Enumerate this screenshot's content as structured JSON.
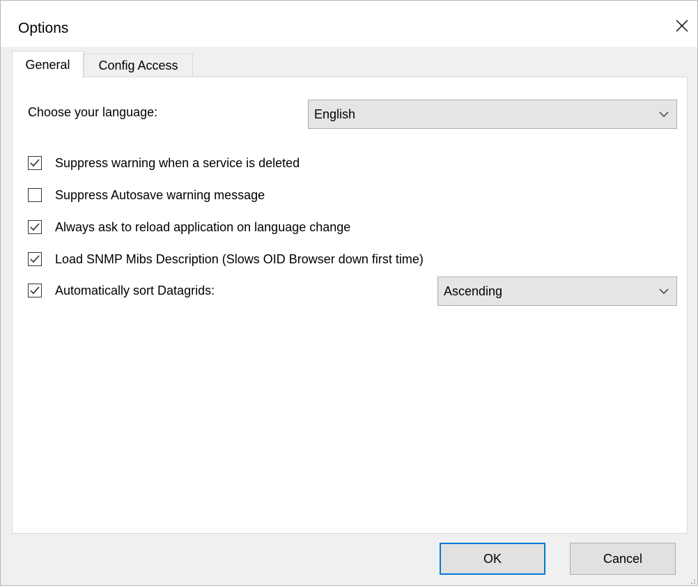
{
  "window": {
    "title": "Options"
  },
  "tabs": [
    {
      "label": "General",
      "active": true
    },
    {
      "label": "Config Access",
      "active": false
    }
  ],
  "general": {
    "language_label": "Choose your language:",
    "language_value": "English",
    "options": [
      {
        "label": "Suppress warning when a service is deleted",
        "checked": true
      },
      {
        "label": "Suppress Autosave warning message",
        "checked": false
      },
      {
        "label": "Always ask to reload application on language change",
        "checked": true
      },
      {
        "label": "Load SNMP Mibs Description  (Slows OID Browser down first time)",
        "checked": true
      },
      {
        "label": "Automatically sort Datagrids:",
        "checked": true
      }
    ],
    "sort_value": "Ascending"
  },
  "buttons": {
    "ok": "OK",
    "cancel": "Cancel"
  },
  "icons": {
    "close": "close-icon",
    "dropdown": "chevron-down-icon",
    "check": "checkmark-icon",
    "grip": "resize-grip-icon"
  },
  "colors": {
    "accent": "#0078d7",
    "window_bg": "#f0f0f0",
    "panel_bg": "#ffffff",
    "button_bg": "#e1e1e1",
    "select_bg": "#e5e5e5"
  }
}
